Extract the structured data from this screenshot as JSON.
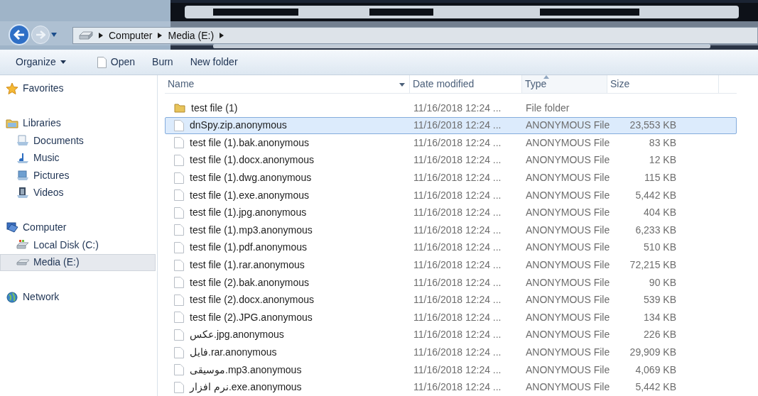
{
  "address_bar": {
    "breadcrumb": [
      "Computer",
      "Media (E:)"
    ]
  },
  "toolbar": [
    {
      "label": "Organize",
      "kind": "menu"
    },
    {
      "label": "Open",
      "kind": "icon"
    },
    {
      "label": "Burn",
      "kind": "plain"
    },
    {
      "label": "New folder",
      "kind": "plain"
    }
  ],
  "sidebar": {
    "groups": [
      {
        "label": "Favorites",
        "kind": "star"
      },
      {
        "label": "Libraries",
        "kind": "library",
        "children": [
          {
            "label": "Documents",
            "kind": "documents",
            "selected": false
          },
          {
            "label": "Music",
            "kind": "music",
            "selected": false
          },
          {
            "label": "Pictures",
            "kind": "pictures",
            "selected": false
          },
          {
            "label": "Videos",
            "kind": "videos",
            "selected": false
          }
        ]
      },
      {
        "label": "Computer",
        "kind": "computer",
        "children": [
          {
            "label": "Local Disk (C:)",
            "kind": "disk",
            "selected": false
          },
          {
            "label": "Media (E:)",
            "kind": "drive",
            "selected": true
          }
        ]
      },
      {
        "label": "Network",
        "kind": "network"
      }
    ]
  },
  "table": {
    "columns": [
      {
        "label": "Name",
        "sorted": false
      },
      {
        "label": "Date modified",
        "sorted": false
      },
      {
        "label": "Type",
        "sorted": true
      },
      {
        "label": "Size",
        "sorted": false
      }
    ],
    "rows": [
      {
        "kind": "folder",
        "name": "test file (1)",
        "date": "11/16/2018 12:24 ...",
        "type": "File folder",
        "selected": false
      },
      {
        "kind": "file",
        "name": "dnSpy.zip.anonymous",
        "date": "11/16/2018 12:24 ...",
        "type": "ANONYMOUS File",
        "size": "23,553 KB",
        "selected": true
      },
      {
        "kind": "file",
        "name": "test file (1).bak.anonymous",
        "date": "11/16/2018 12:24 ...",
        "type": "ANONYMOUS File",
        "size": "83 KB",
        "selected": false
      },
      {
        "kind": "file",
        "name": "test file (1).docx.anonymous",
        "date": "11/16/2018 12:24 ...",
        "type": "ANONYMOUS File",
        "size": "12 KB",
        "selected": false
      },
      {
        "kind": "file",
        "name": "test file (1).dwg.anonymous",
        "date": "11/16/2018 12:24 ...",
        "type": "ANONYMOUS File",
        "size": "115 KB",
        "selected": false
      },
      {
        "kind": "file",
        "name": "test file (1).exe.anonymous",
        "date": "11/16/2018 12:24 ...",
        "type": "ANONYMOUS File",
        "size": "5,442 KB",
        "selected": false
      },
      {
        "kind": "file",
        "name": "test file (1).jpg.anonymous",
        "date": "11/16/2018 12:24 ...",
        "type": "ANONYMOUS File",
        "size": "404 KB",
        "selected": false
      },
      {
        "kind": "file",
        "name": "test file (1).mp3.anonymous",
        "date": "11/16/2018 12:24 ...",
        "type": "ANONYMOUS File",
        "size": "6,233 KB",
        "selected": false
      },
      {
        "kind": "file",
        "name": "test file (1).pdf.anonymous",
        "date": "11/16/2018 12:24 ...",
        "type": "ANONYMOUS File",
        "size": "510 KB",
        "selected": false
      },
      {
        "kind": "file",
        "name": "test file (1).rar.anonymous",
        "date": "11/16/2018 12:24 ...",
        "type": "ANONYMOUS File",
        "size": "72,215 KB",
        "selected": false
      },
      {
        "kind": "file",
        "name": "test file (2).bak.anonymous",
        "date": "11/16/2018 12:24 ...",
        "type": "ANONYMOUS File",
        "size": "90 KB",
        "selected": false
      },
      {
        "kind": "file",
        "name": "test file (2).docx.anonymous",
        "date": "11/16/2018 12:24 ...",
        "type": "ANONYMOUS File",
        "size": "539 KB",
        "selected": false
      },
      {
        "kind": "file",
        "name": "test file (2).JPG.anonymous",
        "date": "11/16/2018 12:24 ...",
        "type": "ANONYMOUS File",
        "size": "134 KB",
        "selected": false
      },
      {
        "kind": "file",
        "name": "عکس.jpg.anonymous",
        "date": "11/16/2018 12:24 ...",
        "type": "ANONYMOUS File",
        "size": "226 KB",
        "selected": false
      },
      {
        "kind": "file",
        "name": "فایل.rar.anonymous",
        "date": "11/16/2018 12:24 ...",
        "type": "ANONYMOUS File",
        "size": "29,909 KB",
        "selected": false
      },
      {
        "kind": "file",
        "name": "موسیقی.mp3.anonymous",
        "date": "11/16/2018 12:24 ...",
        "type": "ANONYMOUS File",
        "size": "4,069 KB",
        "selected": false
      },
      {
        "kind": "file",
        "name": "نرم افزار.exe.anonymous",
        "date": "11/16/2018 12:24 ...",
        "type": "ANONYMOUS File",
        "size": "5,442 KB",
        "selected": false
      }
    ]
  }
}
